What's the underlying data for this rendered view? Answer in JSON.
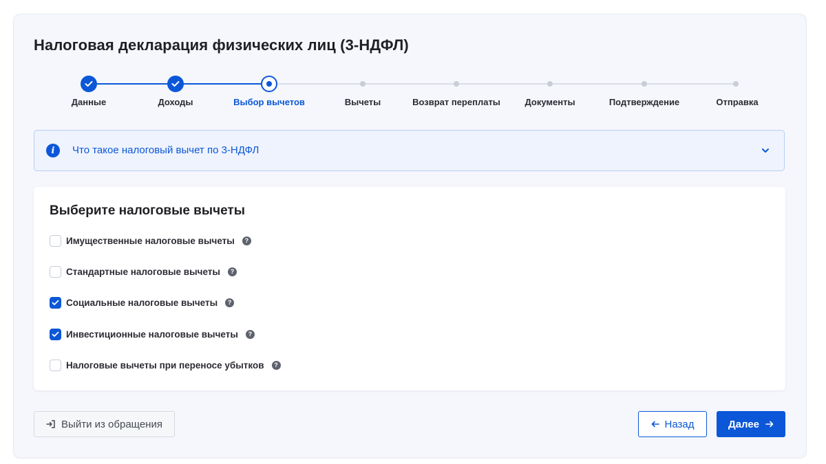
{
  "page_title": "Налоговая декларация физических лиц (3-НДФЛ)",
  "stepper": {
    "steps": [
      {
        "label": "Данные",
        "state": "done"
      },
      {
        "label": "Доходы",
        "state": "done"
      },
      {
        "label": "Выбор вычетов",
        "state": "current"
      },
      {
        "label": "Вычеты",
        "state": "todo"
      },
      {
        "label": "Возврат переплаты",
        "state": "todo"
      },
      {
        "label": "Документы",
        "state": "todo"
      },
      {
        "label": "Подтверждение",
        "state": "todo"
      },
      {
        "label": "Отправка",
        "state": "todo"
      }
    ]
  },
  "info": {
    "icon": "info-icon",
    "text": "Что такое налоговый вычет по 3-НДФЛ",
    "expand_icon": "chevron-down-icon"
  },
  "deductions": {
    "title": "Выберите налоговые вычеты",
    "options": [
      {
        "label": "Имущественные налоговые вычеты",
        "checked": false
      },
      {
        "label": "Стандартные налоговые вычеты",
        "checked": false
      },
      {
        "label": "Социальные налоговые вычеты",
        "checked": true
      },
      {
        "label": "Инвестиционные налоговые вычеты",
        "checked": true
      },
      {
        "label": "Налоговые вычеты при переносе убытков",
        "checked": false
      }
    ],
    "help_glyph": "?"
  },
  "footer": {
    "exit_label": "Выйти из обращения",
    "back_label": "Назад",
    "next_label": "Далее"
  },
  "colors": {
    "accent": "#0b57d8",
    "panel_bg": "#f5f7fc",
    "info_bg": "#eef3fd"
  }
}
